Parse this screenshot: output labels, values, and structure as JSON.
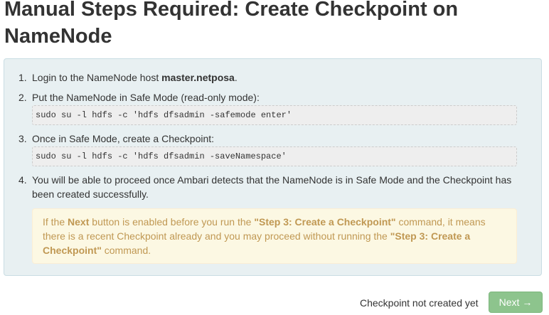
{
  "title": "Manual Steps Required: Create Checkpoint on NameNode",
  "steps": [
    {
      "number": "1.",
      "text_before": "Login to the NameNode host ",
      "host": "master.netposa",
      "text_after": "."
    },
    {
      "number": "2.",
      "text": "Put the NameNode in Safe Mode (read-only mode):",
      "command": "sudo su -l hdfs -c 'hdfs dfsadmin -safemode enter'"
    },
    {
      "number": "3.",
      "text": "Once in Safe Mode, create a Checkpoint:",
      "command": "sudo su -l hdfs -c 'hdfs dfsadmin -saveNamespace'"
    },
    {
      "number": "4.",
      "text": "You will be able to proceed once Ambari detects that the NameNode is in Safe Mode and the Checkpoint has been created successfully."
    }
  ],
  "warning": {
    "part1": "If the ",
    "bold1": "Next",
    "part2": " button is enabled before you run the ",
    "bold2": "\"Step 3: Create a Checkpoint\"",
    "part3": " command, it means there is a recent Checkpoint already and you may proceed without running the ",
    "bold3": "\"Step 3: Create a Checkpoint\"",
    "part4": " command."
  },
  "footer": {
    "status": "Checkpoint not created yet",
    "next_label": "Next →"
  },
  "colors": {
    "info_bg": "#e8f0f2",
    "warning_bg": "#fcf8e3",
    "warning_text": "#c09853",
    "next_button_bg": "#8dc48d"
  }
}
